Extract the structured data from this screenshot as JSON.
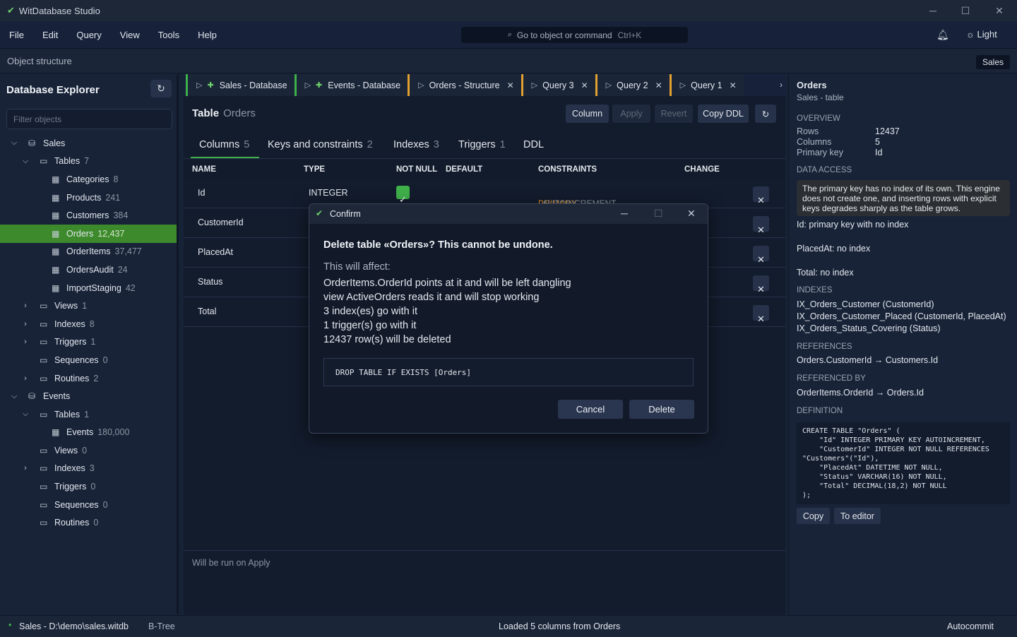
{
  "app": {
    "title": "WitDatabase Studio"
  },
  "menu": [
    "File",
    "Edit",
    "Query",
    "View",
    "Tools",
    "Help"
  ],
  "command": {
    "placeholder": "Go to object or command",
    "shortcut": "Ctrl+K"
  },
  "theme_toggle": "Light",
  "object_bar": {
    "label": "Object structure",
    "context": "Sales"
  },
  "explorer": {
    "title": "Database Explorer",
    "filter_placeholder": "Filter objects",
    "nodes": [
      {
        "label": "Sales",
        "count": "",
        "level": 0,
        "kind": "db",
        "expanded": true
      },
      {
        "label": "Tables",
        "count": "7",
        "level": 1,
        "kind": "folder",
        "expanded": true
      },
      {
        "label": "Categories",
        "count": "8",
        "level": 2,
        "kind": "table"
      },
      {
        "label": "Products",
        "count": "241",
        "level": 2,
        "kind": "table"
      },
      {
        "label": "Customers",
        "count": "384",
        "level": 2,
        "kind": "table"
      },
      {
        "label": "Orders",
        "count": "12,437",
        "level": 2,
        "kind": "table",
        "selected": true
      },
      {
        "label": "OrderItems",
        "count": "37,477",
        "level": 2,
        "kind": "table"
      },
      {
        "label": "OrdersAudit",
        "count": "24",
        "level": 2,
        "kind": "table"
      },
      {
        "label": "ImportStaging",
        "count": "42",
        "level": 2,
        "kind": "table"
      },
      {
        "label": "Views",
        "count": "1",
        "level": 1,
        "kind": "folder",
        "expanded": false
      },
      {
        "label": "Indexes",
        "count": "8",
        "level": 1,
        "kind": "folder",
        "expanded": false
      },
      {
        "label": "Triggers",
        "count": "1",
        "level": 1,
        "kind": "folder",
        "expanded": false
      },
      {
        "label": "Sequences",
        "count": "0",
        "level": 1,
        "kind": "folder"
      },
      {
        "label": "Routines",
        "count": "2",
        "level": 1,
        "kind": "folder",
        "expanded": false
      },
      {
        "label": "Events",
        "count": "",
        "level": 0,
        "kind": "db",
        "expanded": true
      },
      {
        "label": "Tables",
        "count": "1",
        "level": 1,
        "kind": "folder",
        "expanded": true
      },
      {
        "label": "Events",
        "count": "180,000",
        "level": 2,
        "kind": "table"
      },
      {
        "label": "Views",
        "count": "0",
        "level": 1,
        "kind": "folder"
      },
      {
        "label": "Indexes",
        "count": "3",
        "level": 1,
        "kind": "folder",
        "expanded": false
      },
      {
        "label": "Triggers",
        "count": "0",
        "level": 1,
        "kind": "folder"
      },
      {
        "label": "Sequences",
        "count": "0",
        "level": 1,
        "kind": "folder"
      },
      {
        "label": "Routines",
        "count": "0",
        "level": 1,
        "kind": "folder"
      }
    ]
  },
  "tabs": [
    {
      "label": "Sales - Database",
      "type": "db",
      "closable": false
    },
    {
      "label": "Events - Database",
      "type": "db",
      "closable": false
    },
    {
      "label": "Orders - Structure",
      "type": "struct",
      "closable": true
    },
    {
      "label": "Query 3",
      "type": "query",
      "closable": true
    },
    {
      "label": "Query 2",
      "type": "query",
      "closable": true
    },
    {
      "label": "Query 1",
      "type": "query",
      "closable": true
    }
  ],
  "table_header": {
    "kind": "Table",
    "name": "Orders"
  },
  "toolbar": {
    "column": "Column",
    "apply": "Apply",
    "revert": "Revert",
    "copy_ddl": "Copy DDL"
  },
  "subtabs": [
    {
      "label": "Columns",
      "count": "5"
    },
    {
      "label": "Keys and constraints",
      "count": "2"
    },
    {
      "label": "Indexes",
      "count": "3"
    },
    {
      "label": "Triggers",
      "count": "1"
    },
    {
      "label": "DDL",
      "count": ""
    }
  ],
  "grid": {
    "headers": {
      "name": "NAME",
      "type": "TYPE",
      "not_null": "NOT NULL",
      "default": "DEFAULT",
      "constraints": "CONSTRAINTS",
      "change": "CHANGE"
    },
    "rows": [
      {
        "name": "Id",
        "type": "INTEGER",
        "not_null": true,
        "pk": "PRIMARY KEY",
        "extra": "AUTOINCREMENT"
      },
      {
        "name": "CustomerId"
      },
      {
        "name": "PlacedAt"
      },
      {
        "name": "Status"
      },
      {
        "name": "Total"
      }
    ]
  },
  "footer_note": "Will be run on Apply",
  "details": {
    "title": "Orders",
    "subtitle": "Sales - table",
    "overview_h": "Overview",
    "rows_k": "Rows",
    "rows_v": "12437",
    "cols_k": "Columns",
    "cols_v": "5",
    "pk_k": "Primary key",
    "pk_v": "Id",
    "access_h": "Data access",
    "warning": "The primary key has no index of its own. This engine does not create one, and inserting rows with explicit keys degrades sharply as the table grows.",
    "notes": [
      "Id: primary key with no index",
      "PlacedAt: no index",
      "Total: no index"
    ],
    "indexes_h": "Indexes",
    "indexes": [
      "IX_Orders_Customer (CustomerId)",
      "IX_Orders_Customer_Placed (CustomerId, PlacedAt)",
      "IX_Orders_Status_Covering (Status)"
    ],
    "references_h": "References",
    "references": "Orders.CustomerId → Customers.Id",
    "referenced_h": "Referenced by",
    "referenced": "OrderItems.OrderId → Orders.Id",
    "definition_h": "Definition",
    "definition": "CREATE TABLE \"Orders\" (\n    \"Id\" INTEGER PRIMARY KEY AUTOINCREMENT,\n    \"CustomerId\" INTEGER NOT NULL REFERENCES\n\"Customers\"(\"Id\"),\n    \"PlacedAt\" DATETIME NOT NULL,\n    \"Status\" VARCHAR(16) NOT NULL,\n    \"Total\" DECIMAL(18,2) NOT NULL\n);",
    "copy": "Copy",
    "to_editor": "To editor"
  },
  "status": {
    "db": "Sales - D:\\demo\\sales.witdb",
    "engine": "B-Tree",
    "message": "Loaded 5 columns from Orders",
    "mode": "Autocommit"
  },
  "dialog": {
    "title": "Confirm",
    "heading": "Delete table «Orders»? This cannot be undone.",
    "affects": "This will affect:",
    "lines": [
      "OrderItems.OrderId points at it and will be left dangling",
      "view ActiveOrders reads it and will stop working",
      "3 index(es) go with it",
      "1 trigger(s) go with it",
      "12437 row(s) will be deleted"
    ],
    "sql": "DROP TABLE IF EXISTS [Orders]",
    "cancel": "Cancel",
    "delete": "Delete"
  },
  "colors": {
    "accent_green": "#3fb04a",
    "tab_orange": "#e2a030",
    "pk_orange": "#e89a2d"
  }
}
